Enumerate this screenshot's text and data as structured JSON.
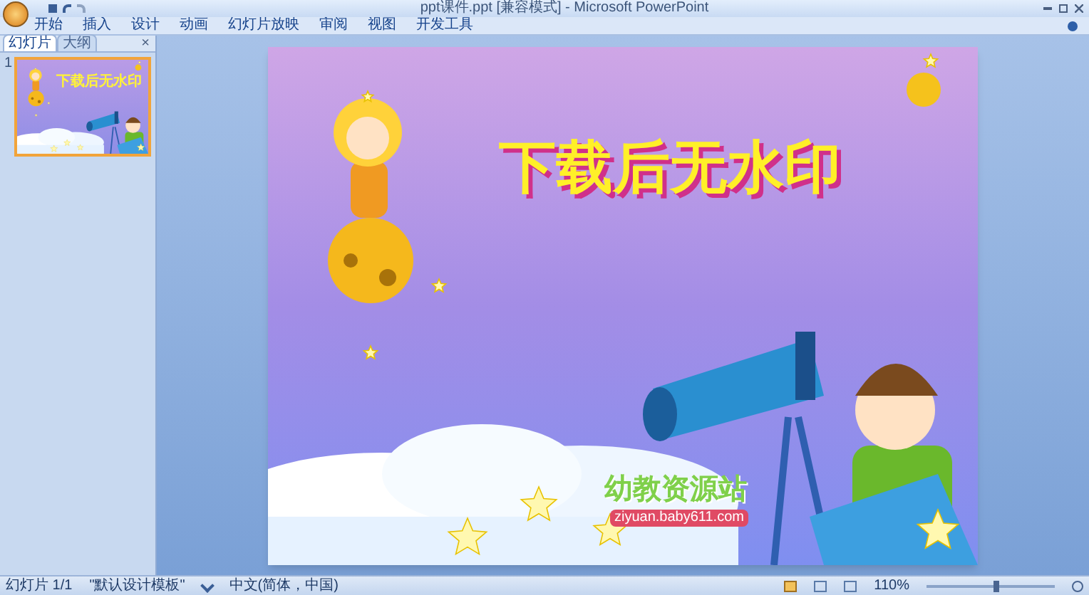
{
  "window": {
    "title": "ppt课件.ppt [兼容模式] - Microsoft PowerPoint"
  },
  "ribbon_tabs": [
    "开始",
    "插入",
    "设计",
    "动画",
    "幻灯片放映",
    "审阅",
    "视图",
    "开发工具"
  ],
  "pane_tabs": [
    {
      "label": "幻灯片",
      "selected": true
    },
    {
      "label": "大纲",
      "selected": false
    }
  ],
  "pane_close": "×",
  "thumbnails": [
    {
      "number": "1",
      "title": "下载后无水印",
      "selected": true
    }
  ],
  "slide": {
    "title": "下载后无水印",
    "logo_title": "幼教资源站",
    "logo_url": "ziyuan.baby611.com"
  },
  "status_bar": {
    "slide": "幻灯片 1/1",
    "theme": "\"默认设计模板\"",
    "language": "中文(简体，中国)",
    "zoom": "110%",
    "zoom_slider": {
      "level": 0.55
    }
  }
}
